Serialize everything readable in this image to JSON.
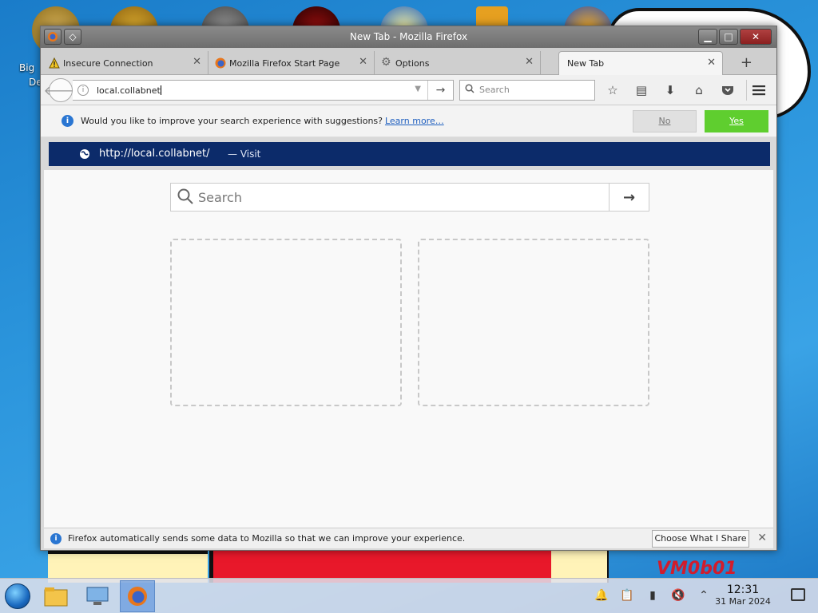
{
  "window": {
    "title": "New Tab - Mozilla Firefox"
  },
  "desktop": {
    "icon_label": "Big",
    "icon_label2": "De",
    "wallpaper_text": "VM0b01"
  },
  "tabs": [
    {
      "label": "Insecure Connection",
      "icon": "warning-icon"
    },
    {
      "label": "Mozilla Firefox Start Page",
      "icon": "firefox-icon"
    },
    {
      "label": "Options",
      "icon": "gear-icon"
    },
    {
      "label": "New Tab",
      "icon": "",
      "active": true
    }
  ],
  "navbar": {
    "url_value": "local.collabnet",
    "search_placeholder": "Search"
  },
  "notification": {
    "text": "Would you like to improve your search experience with suggestions?",
    "link": "Learn more…",
    "no_label": "No",
    "yes_label": "Yes"
  },
  "suggestion": {
    "url": "http://local.collabnet/",
    "action": "— Visit"
  },
  "newtab": {
    "search_placeholder": "Search"
  },
  "statusbar": {
    "text": "Firefox automatically sends some data to Mozilla so that we can improve your experience.",
    "button_label": "Choose What I Share"
  },
  "taskbar": {
    "time": "12:31",
    "date": "31 Mar 2024"
  },
  "colors": {
    "accent_yes": "#5fce2f",
    "suggest_bg": "#0c2b6a",
    "info_blue": "#2a76d2"
  }
}
